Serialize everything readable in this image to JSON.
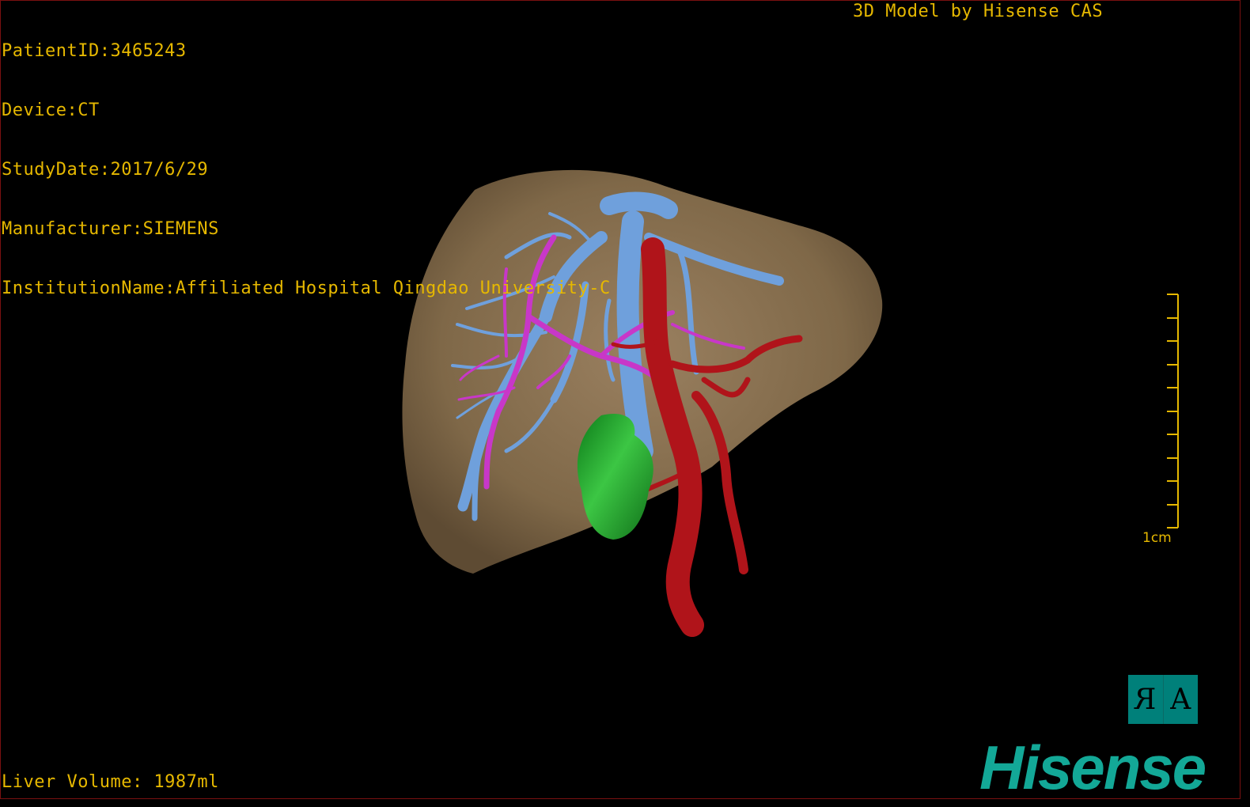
{
  "overlay": {
    "patient_id": "PatientID:3465243",
    "device": "Device:CT",
    "study_date": "StudyDate:2017/6/29",
    "manufacturer": "Manufacturer:SIEMENS",
    "institution": "InstitutionName:Affiliated Hospital Qingdao University-C",
    "credit": "3D Model by Hisense CAS",
    "liver_volume": "Liver Volume: 1987ml"
  },
  "scale_bar": {
    "label": "1cm"
  },
  "orientation_cube": {
    "left_glyph": "R",
    "right_glyph": "A"
  },
  "brand": {
    "logo_text": "Hisense",
    "color": "#13a897"
  },
  "colors": {
    "overlay_text": "#e6b800",
    "liver": "#8f7656",
    "portal_vein": "#6fa0dc",
    "hepatic_artery": "#b0141a",
    "biliary": "#c837c8",
    "lesion": "#1e9e2a",
    "background": "#000000"
  }
}
